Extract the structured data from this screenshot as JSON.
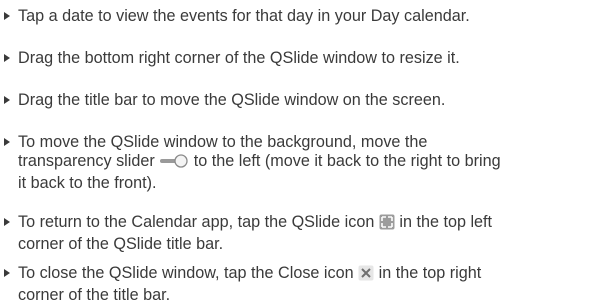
{
  "bullets": [
    {
      "lines": [
        "Tap a date to view the events for that day in your Day calendar."
      ]
    },
    {
      "lines": [
        "Drag the bottom right corner of the QSlide window to resize it."
      ]
    },
    {
      "lines": [
        "Drag the title bar to move the QSlide window on the screen."
      ]
    },
    {
      "lines": [
        "To move the QSlide window to the background, move the",
        "transparency slider",
        "to the left (move it back to the right to bring",
        "it back to the front)."
      ]
    },
    {
      "lines": [
        "To return to the Calendar app, tap the QSlide icon",
        "in the top left",
        "corner of the QSlide title bar."
      ]
    },
    {
      "lines": [
        "To close the QSlide window, tap the Close icon",
        "in the top right",
        "corner of the title bar."
      ]
    }
  ],
  "icons": {
    "bullet": "triangle-bullet-icon",
    "slider": "transparency-slider-icon",
    "qslide": "qslide-icon",
    "close": "close-icon"
  },
  "colors": {
    "text": "#3a3a3a",
    "icon_gray": "#9a9a9a"
  }
}
